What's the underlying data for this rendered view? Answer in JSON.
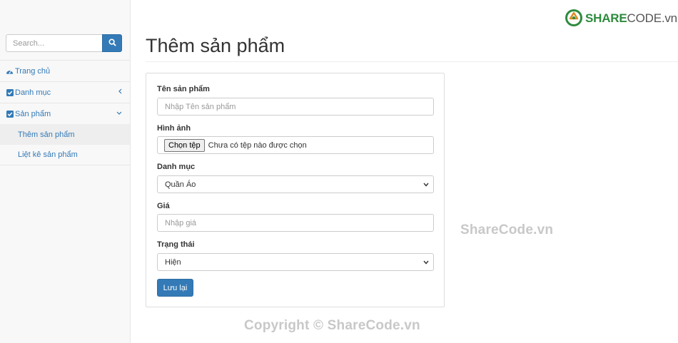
{
  "sidebar": {
    "search_placeholder": "Search...",
    "items": [
      {
        "label": "Trang chủ",
        "icon": "dashboard-icon"
      },
      {
        "label": "Danh mục",
        "icon": "checkbox-icon",
        "caret": "chevron-left-icon"
      },
      {
        "label": "Sản phẩm",
        "icon": "checkbox-icon",
        "caret": "chevron-down-icon"
      }
    ],
    "sub_items": [
      {
        "label": "Thêm sản phẩm",
        "active": true
      },
      {
        "label": "Liệt kê sản phẩm",
        "active": false
      }
    ]
  },
  "logo": {
    "brand_bold": "SHARE",
    "brand_thin": "CODE.vn"
  },
  "page": {
    "title": "Thêm sản phẩm"
  },
  "form": {
    "name_label": "Tên sản phẩm",
    "name_placeholder": "Nhập Tên sản phẩm",
    "image_label": "Hình ảnh",
    "file_button": "Chọn tệp",
    "file_status": "Chưa có tệp nào được chọn",
    "category_label": "Danh mục",
    "category_value": "Quần Áo",
    "price_label": "Giá",
    "price_placeholder": "Nhập giá",
    "status_label": "Trạng thái",
    "status_value": "Hiện",
    "save_label": "Lưu lại"
  },
  "watermark": {
    "side": "ShareCode.vn",
    "bottom": "Copyright © ShareCode.vn"
  },
  "colors": {
    "primary": "#337ab7",
    "logo_green": "#2e8b3e"
  }
}
